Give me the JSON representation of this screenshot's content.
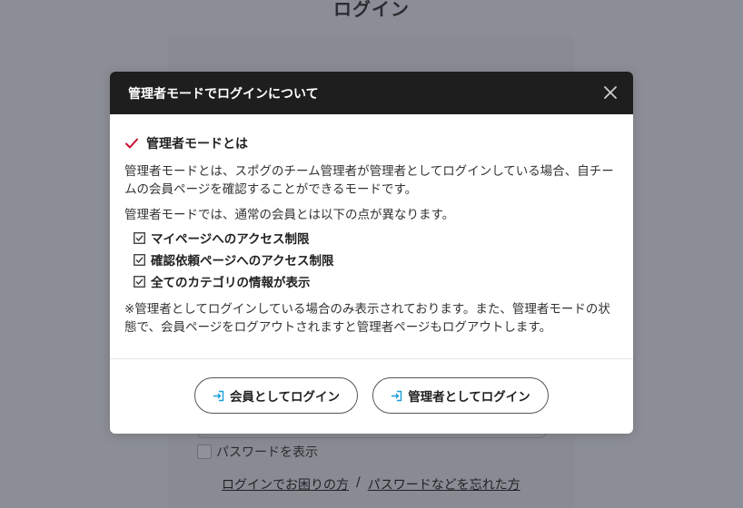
{
  "background": {
    "page_title": "ログイン",
    "show_password_label": "パスワードを表示",
    "link_trouble": "ログインでお困りの方",
    "link_separator": "/",
    "link_forgot": "パスワードなどを忘れた方"
  },
  "modal": {
    "title": "管理者モードでログインについて",
    "section_heading": "管理者モードとは",
    "description": "管理者モードとは、スポグのチーム管理者が管理者としてログインしている場合、自チームの会員ページを確認することができるモードです。",
    "differences_intro": "管理者モードでは、通常の会員とは以下の点が異なります。",
    "differences": [
      "マイページへのアクセス制限",
      "確認依頼ページへのアクセス制限",
      "全てのカテゴリの情報が表示"
    ],
    "note": "※管理者としてログインしている場合のみ表示されております。また、管理者モードの状態で、会員ページをログアウトされますと管理者ページもログアウトします。",
    "member_login_label": "会員としてログイン",
    "admin_login_label": "管理者としてログイン"
  },
  "colors": {
    "accent_check": "#c8102e",
    "login_icon": "#1a9fd8",
    "header_bg": "#1e1e1e",
    "overlay_bg": "#8b8e96"
  },
  "icons": {
    "close": "close-icon",
    "heading_check": "checkmark-icon",
    "list_check": "checkbox-checked-icon",
    "login": "login-arrow-icon"
  }
}
